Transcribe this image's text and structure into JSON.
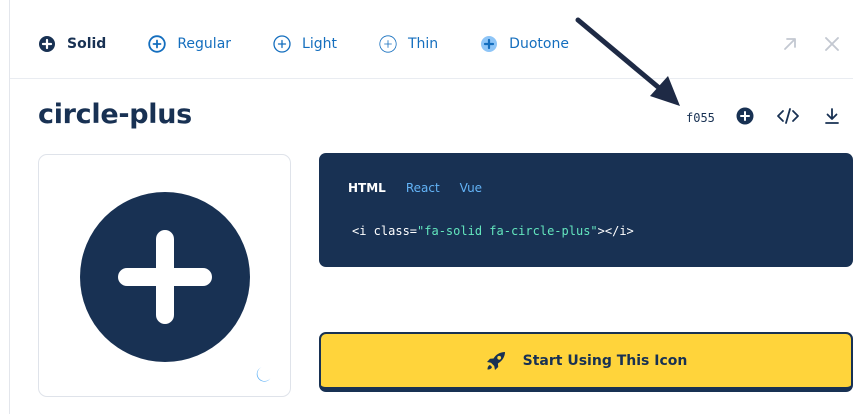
{
  "style_tabs": [
    {
      "label": "Solid",
      "icon": "circle-plus-solid-icon",
      "active": true
    },
    {
      "label": "Regular",
      "icon": "circle-plus-regular-icon",
      "active": false
    },
    {
      "label": "Light",
      "icon": "circle-plus-light-icon",
      "active": false
    },
    {
      "label": "Thin",
      "icon": "circle-plus-thin-icon",
      "active": false
    },
    {
      "label": "Duotone",
      "icon": "circle-plus-duotone-icon",
      "active": false
    }
  ],
  "window_controls": {
    "expand_icon": "arrow-up-right-icon",
    "close_icon": "close-icon"
  },
  "icon_title": "circle-plus",
  "unicode": "f055",
  "actions": [
    "add-to-kit-icon",
    "code-icon",
    "download-icon"
  ],
  "code_panel": {
    "tabs": [
      "HTML",
      "React",
      "Vue"
    ],
    "active_tab": "HTML",
    "code_prefix": "<i class=",
    "code_string": "\"fa-solid fa-circle-plus\"",
    "code_suffix": "></i>"
  },
  "cta": {
    "label": "Start Using This Icon",
    "icon": "rocket-icon"
  },
  "preview": {
    "icon": "circle-plus-icon",
    "theme_toggle": "moon-icon"
  },
  "colors": {
    "navy": "#183153",
    "blue": "#146ebe",
    "light_blue": "#63b3f6",
    "yellow": "#ffd43b",
    "string_green": "#63e6be"
  }
}
